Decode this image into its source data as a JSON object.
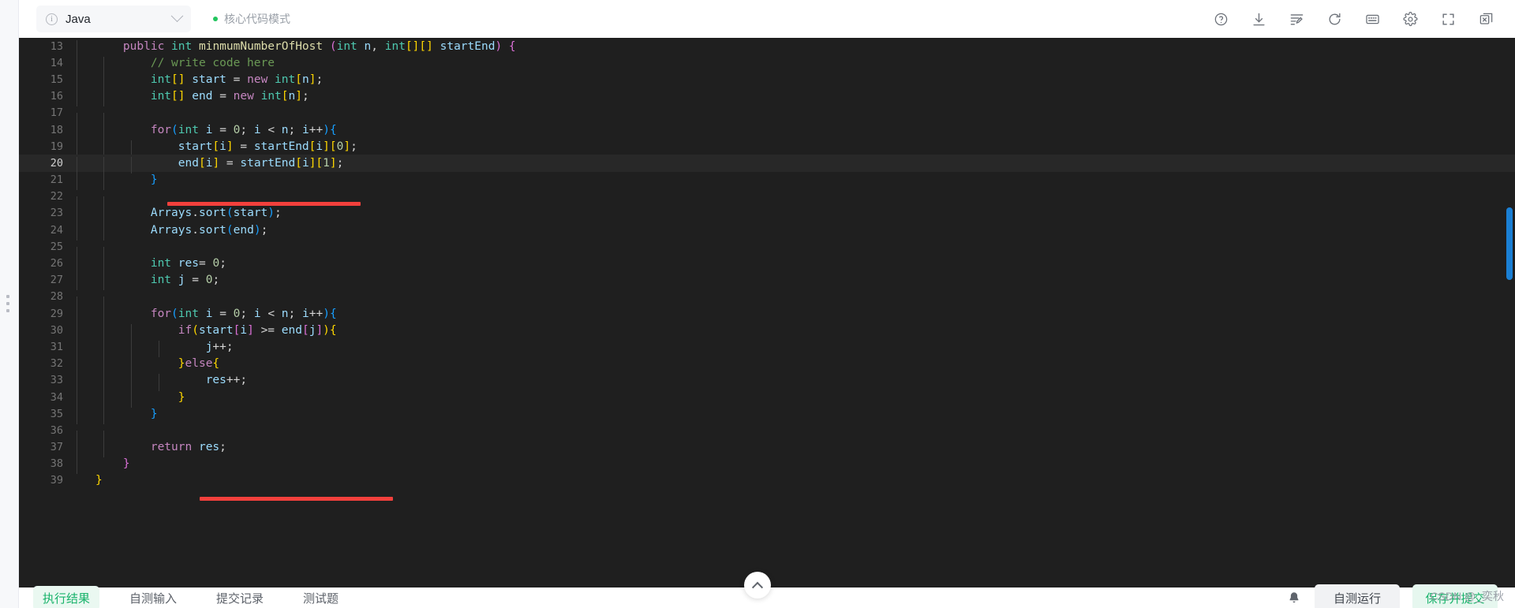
{
  "header": {
    "language": "Java",
    "info_icon": "info-circle-icon",
    "dropdown_icon": "chevron-down-icon",
    "mode_label": "核心代码模式",
    "mode_dot_color": "#22c55e",
    "icons": [
      {
        "name": "help-icon",
        "title": "帮助"
      },
      {
        "name": "download-icon",
        "title": "下载"
      },
      {
        "name": "format-code-icon",
        "title": "格式化"
      },
      {
        "name": "refresh-icon",
        "title": "重置"
      },
      {
        "name": "keyboard-icon",
        "title": "快捷键"
      },
      {
        "name": "settings-icon",
        "title": "设置"
      },
      {
        "name": "fullscreen-icon",
        "title": "全屏"
      },
      {
        "name": "close-window-icon",
        "title": "关闭"
      }
    ]
  },
  "editor": {
    "theme_background": "#1f1f1f",
    "active_line": 20,
    "scrollbar_color": "#1a7fd4",
    "annotation_color": "#f2403c",
    "lines": [
      {
        "n": 13,
        "indent": 0
      },
      {
        "n": 14,
        "indent": 1
      },
      {
        "n": 15,
        "indent": 1
      },
      {
        "n": 16,
        "indent": 1
      },
      {
        "n": 17,
        "indent": 1
      },
      {
        "n": 18,
        "indent": 1
      },
      {
        "n": 19,
        "indent": 2
      },
      {
        "n": 20,
        "indent": 2
      },
      {
        "n": 21,
        "indent": 1
      },
      {
        "n": 22,
        "indent": 1
      },
      {
        "n": 23,
        "indent": 1
      },
      {
        "n": 24,
        "indent": 1
      },
      {
        "n": 25,
        "indent": 1
      },
      {
        "n": 26,
        "indent": 1
      },
      {
        "n": 27,
        "indent": 1
      },
      {
        "n": 28,
        "indent": 1
      },
      {
        "n": 29,
        "indent": 1
      },
      {
        "n": 30,
        "indent": 2
      },
      {
        "n": 31,
        "indent": 3
      },
      {
        "n": 32,
        "indent": 2
      },
      {
        "n": 33,
        "indent": 3
      },
      {
        "n": 34,
        "indent": 2
      },
      {
        "n": 35,
        "indent": 1
      },
      {
        "n": 36,
        "indent": 1
      },
      {
        "n": 37,
        "indent": 1
      },
      {
        "n": 38,
        "indent": 0
      },
      {
        "n": 39,
        "indent": 0
      }
    ],
    "source": [
      "    public int minmumNumberOfHost (int n, int[][] startEnd) {",
      "        // write code here",
      "        int[] start = new int[n];",
      "        int[] end = new int[n];",
      "",
      "        for(int i = 0; i < n; i++){",
      "            start[i] = startEnd[i][0];",
      "            end[i] = startEnd[i][1];",
      "        }",
      "",
      "        Arrays.sort(start);",
      "        Arrays.sort(end);",
      "",
      "        int res= 0;",
      "        int j = 0;",
      "",
      "        for(int i = 0; i < n; i++){",
      "            if(start[i] >= end[j]){",
      "                j++;",
      "            }else{",
      "                res++;",
      "            }",
      "        }",
      "",
      "        return res;",
      "    }",
      "}"
    ]
  },
  "collapse_button": {
    "icon": "chevron-up-icon"
  },
  "footer": {
    "tabs": [
      {
        "label": "执行结果",
        "active": true
      },
      {
        "label": "自测输入",
        "active": false
      },
      {
        "label": "提交记录",
        "active": false
      },
      {
        "label": "测试题",
        "active": false
      }
    ],
    "bell_icon": "bell-icon",
    "buttons": [
      {
        "label": "自测运行",
        "style": "secondary"
      },
      {
        "label": "保存并提交",
        "style": "primary"
      }
    ]
  },
  "watermark": "CSDN @_奕秋"
}
